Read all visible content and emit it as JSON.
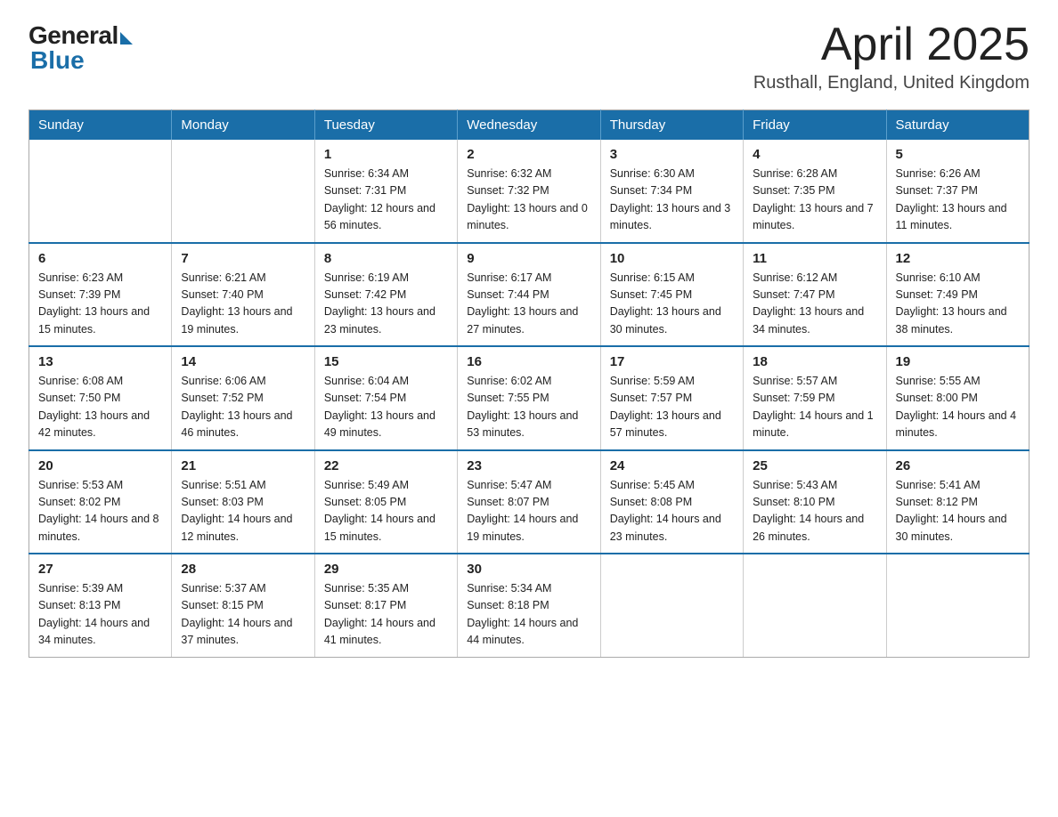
{
  "logo": {
    "general": "General",
    "blue": "Blue"
  },
  "title": "April 2025",
  "location": "Rusthall, England, United Kingdom",
  "weekdays": [
    "Sunday",
    "Monday",
    "Tuesday",
    "Wednesday",
    "Thursday",
    "Friday",
    "Saturday"
  ],
  "weeks": [
    [
      {
        "day": "",
        "info": ""
      },
      {
        "day": "",
        "info": ""
      },
      {
        "day": "1",
        "info": "Sunrise: 6:34 AM\nSunset: 7:31 PM\nDaylight: 12 hours\nand 56 minutes."
      },
      {
        "day": "2",
        "info": "Sunrise: 6:32 AM\nSunset: 7:32 PM\nDaylight: 13 hours\nand 0 minutes."
      },
      {
        "day": "3",
        "info": "Sunrise: 6:30 AM\nSunset: 7:34 PM\nDaylight: 13 hours\nand 3 minutes."
      },
      {
        "day": "4",
        "info": "Sunrise: 6:28 AM\nSunset: 7:35 PM\nDaylight: 13 hours\nand 7 minutes."
      },
      {
        "day": "5",
        "info": "Sunrise: 6:26 AM\nSunset: 7:37 PM\nDaylight: 13 hours\nand 11 minutes."
      }
    ],
    [
      {
        "day": "6",
        "info": "Sunrise: 6:23 AM\nSunset: 7:39 PM\nDaylight: 13 hours\nand 15 minutes."
      },
      {
        "day": "7",
        "info": "Sunrise: 6:21 AM\nSunset: 7:40 PM\nDaylight: 13 hours\nand 19 minutes."
      },
      {
        "day": "8",
        "info": "Sunrise: 6:19 AM\nSunset: 7:42 PM\nDaylight: 13 hours\nand 23 minutes."
      },
      {
        "day": "9",
        "info": "Sunrise: 6:17 AM\nSunset: 7:44 PM\nDaylight: 13 hours\nand 27 minutes."
      },
      {
        "day": "10",
        "info": "Sunrise: 6:15 AM\nSunset: 7:45 PM\nDaylight: 13 hours\nand 30 minutes."
      },
      {
        "day": "11",
        "info": "Sunrise: 6:12 AM\nSunset: 7:47 PM\nDaylight: 13 hours\nand 34 minutes."
      },
      {
        "day": "12",
        "info": "Sunrise: 6:10 AM\nSunset: 7:49 PM\nDaylight: 13 hours\nand 38 minutes."
      }
    ],
    [
      {
        "day": "13",
        "info": "Sunrise: 6:08 AM\nSunset: 7:50 PM\nDaylight: 13 hours\nand 42 minutes."
      },
      {
        "day": "14",
        "info": "Sunrise: 6:06 AM\nSunset: 7:52 PM\nDaylight: 13 hours\nand 46 minutes."
      },
      {
        "day": "15",
        "info": "Sunrise: 6:04 AM\nSunset: 7:54 PM\nDaylight: 13 hours\nand 49 minutes."
      },
      {
        "day": "16",
        "info": "Sunrise: 6:02 AM\nSunset: 7:55 PM\nDaylight: 13 hours\nand 53 minutes."
      },
      {
        "day": "17",
        "info": "Sunrise: 5:59 AM\nSunset: 7:57 PM\nDaylight: 13 hours\nand 57 minutes."
      },
      {
        "day": "18",
        "info": "Sunrise: 5:57 AM\nSunset: 7:59 PM\nDaylight: 14 hours\nand 1 minute."
      },
      {
        "day": "19",
        "info": "Sunrise: 5:55 AM\nSunset: 8:00 PM\nDaylight: 14 hours\nand 4 minutes."
      }
    ],
    [
      {
        "day": "20",
        "info": "Sunrise: 5:53 AM\nSunset: 8:02 PM\nDaylight: 14 hours\nand 8 minutes."
      },
      {
        "day": "21",
        "info": "Sunrise: 5:51 AM\nSunset: 8:03 PM\nDaylight: 14 hours\nand 12 minutes."
      },
      {
        "day": "22",
        "info": "Sunrise: 5:49 AM\nSunset: 8:05 PM\nDaylight: 14 hours\nand 15 minutes."
      },
      {
        "day": "23",
        "info": "Sunrise: 5:47 AM\nSunset: 8:07 PM\nDaylight: 14 hours\nand 19 minutes."
      },
      {
        "day": "24",
        "info": "Sunrise: 5:45 AM\nSunset: 8:08 PM\nDaylight: 14 hours\nand 23 minutes."
      },
      {
        "day": "25",
        "info": "Sunrise: 5:43 AM\nSunset: 8:10 PM\nDaylight: 14 hours\nand 26 minutes."
      },
      {
        "day": "26",
        "info": "Sunrise: 5:41 AM\nSunset: 8:12 PM\nDaylight: 14 hours\nand 30 minutes."
      }
    ],
    [
      {
        "day": "27",
        "info": "Sunrise: 5:39 AM\nSunset: 8:13 PM\nDaylight: 14 hours\nand 34 minutes."
      },
      {
        "day": "28",
        "info": "Sunrise: 5:37 AM\nSunset: 8:15 PM\nDaylight: 14 hours\nand 37 minutes."
      },
      {
        "day": "29",
        "info": "Sunrise: 5:35 AM\nSunset: 8:17 PM\nDaylight: 14 hours\nand 41 minutes."
      },
      {
        "day": "30",
        "info": "Sunrise: 5:34 AM\nSunset: 8:18 PM\nDaylight: 14 hours\nand 44 minutes."
      },
      {
        "day": "",
        "info": ""
      },
      {
        "day": "",
        "info": ""
      },
      {
        "day": "",
        "info": ""
      }
    ]
  ]
}
